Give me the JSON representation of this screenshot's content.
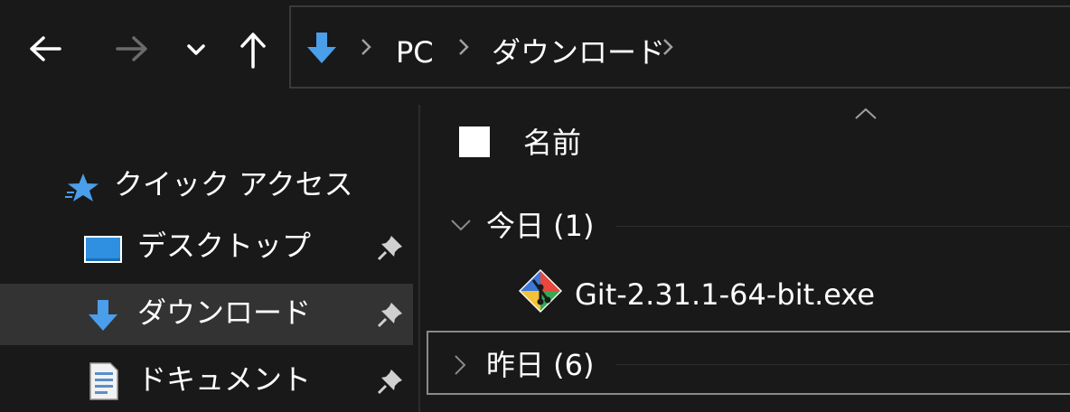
{
  "toolbar": {
    "back_icon": "back-arrow-icon",
    "forward_icon": "forward-arrow-icon",
    "recent_icon": "chevron-down-icon",
    "up_icon": "up-arrow-icon"
  },
  "address_bar": {
    "location_icon": "downloads-icon",
    "crumbs": [
      "PC",
      "ダウンロード"
    ]
  },
  "nav_pane": {
    "quick_access": {
      "label": "クイック アクセス",
      "icon": "star-icon"
    },
    "items": [
      {
        "label": "デスクトップ",
        "icon": "desktop-icon",
        "pinned": true
      },
      {
        "label": "ダウンロード",
        "icon": "downloads-icon",
        "pinned": true,
        "selected": true
      },
      {
        "label": "ドキュメント",
        "icon": "document-icon",
        "pinned": true
      }
    ]
  },
  "content": {
    "column_header": "名前",
    "groups": [
      {
        "label": "今日 (1)",
        "expanded": true,
        "files": [
          {
            "name": "Git-2.31.1-64-bit.exe",
            "icon": "git-icon"
          }
        ]
      },
      {
        "label": "昨日 (6)",
        "expanded": false
      }
    ]
  },
  "colors": {
    "background": "#191919",
    "selected": "#333333",
    "accent_blue": "#4a9eea"
  }
}
